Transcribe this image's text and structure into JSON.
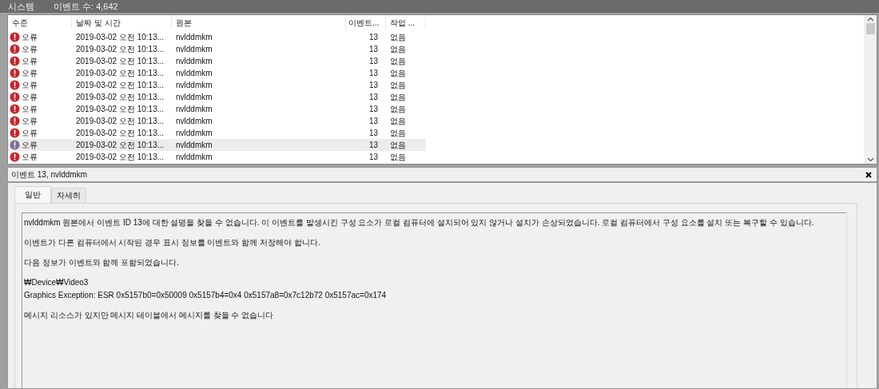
{
  "header": {
    "title": "시스템",
    "count": "이벤트 수: 4,642"
  },
  "table": {
    "columns": [
      "수준",
      "날짜 및 시간",
      "원본",
      "이벤트...",
      "작업 ..."
    ],
    "rows": [
      {
        "level": "오류",
        "date": "2019-03-02 오전 10:13...",
        "source": "nvlddmkm",
        "event_id": "13",
        "task": "없음",
        "selected": false
      },
      {
        "level": "오류",
        "date": "2019-03-02 오전 10:13...",
        "source": "nvlddmkm",
        "event_id": "13",
        "task": "없음",
        "selected": false
      },
      {
        "level": "오류",
        "date": "2019-03-02 오전 10:13...",
        "source": "nvlddmkm",
        "event_id": "13",
        "task": "없음",
        "selected": false
      },
      {
        "level": "오류",
        "date": "2019-03-02 오전 10:13...",
        "source": "nvlddmkm",
        "event_id": "13",
        "task": "없음",
        "selected": false
      },
      {
        "level": "오류",
        "date": "2019-03-02 오전 10:13...",
        "source": "nvlddmkm",
        "event_id": "13",
        "task": "없음",
        "selected": false
      },
      {
        "level": "오류",
        "date": "2019-03-02 오전 10:13...",
        "source": "nvlddmkm",
        "event_id": "13",
        "task": "없음",
        "selected": false
      },
      {
        "level": "오류",
        "date": "2019-03-02 오전 10:13...",
        "source": "nvlddmkm",
        "event_id": "13",
        "task": "없음",
        "selected": false
      },
      {
        "level": "오류",
        "date": "2019-03-02 오전 10:13...",
        "source": "nvlddmkm",
        "event_id": "13",
        "task": "없음",
        "selected": false
      },
      {
        "level": "오류",
        "date": "2019-03-02 오전 10:13...",
        "source": "nvlddmkm",
        "event_id": "13",
        "task": "없음",
        "selected": false
      },
      {
        "level": "오류",
        "date": "2019-03-02 오전 10:13...",
        "source": "nvlddmkm",
        "event_id": "13",
        "task": "없음",
        "selected": true
      },
      {
        "level": "오류",
        "date": "2019-03-02 오전 10:13...",
        "source": "nvlddmkm",
        "event_id": "13",
        "task": "없음",
        "selected": false
      }
    ]
  },
  "detail": {
    "title": "이벤트 13, nvlddmkm",
    "tabs": [
      {
        "label": "일반",
        "selected": true
      },
      {
        "label": "자세히",
        "selected": false
      }
    ],
    "paragraphs": [
      [
        "nvlddmkm 원본에서 이벤트 ID 13에 대한 설명을 찾을 수 없습니다. 이 이벤트를 발생시킨 구성 요소가 로컬 컴퓨터에 설치되어 있지 않거나 설치가 손상되었습니다. 로컬 컴퓨터에서 구성 요소를 설치 또는 복구할 수 있습니다."
      ],
      [
        "이벤트가 다른 컴퓨터에서 시작된 경우 표시 정보를 이벤트와 함께 저장해야 합니다."
      ],
      [
        "다음 정보가 이벤트와 함께 포함되었습니다."
      ],
      [
        "₩Device₩Video3",
        "Graphics Exception: ESR 0x5157b0=0x50009 0x5157b4=0x4 0x5157a8=0x7c12b72 0x5157ac=0x174"
      ],
      [
        "메시지 리소스가 있지만 메시지 테이블에서 메시지를 찾을 수 없습니다"
      ]
    ]
  }
}
